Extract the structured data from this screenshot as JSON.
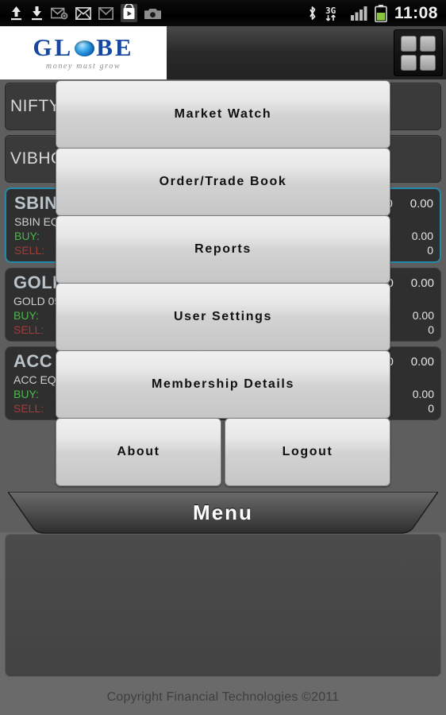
{
  "statusbar": {
    "time": "11:08",
    "left_icons": [
      "upload-icon",
      "download-icon",
      "mail-sync-icon",
      "mail-icon",
      "gmail-icon",
      "play-store-icon",
      "camera-icon"
    ],
    "right_icons": [
      "bluetooth-icon",
      "3g-data-icon",
      "signal-icon",
      "battery-icon"
    ],
    "network_label": "3G"
  },
  "titlebar": {
    "logo_prefix": "GL",
    "logo_suffix": "BE",
    "logo_tagline": "money must grow",
    "grid_icon": "grid-menu-icon"
  },
  "watchlist": {
    "rows": [
      {
        "type": "simple",
        "name": "NIFTY",
        "icon": "chart-icon",
        "values": []
      },
      {
        "type": "simple",
        "name": "VIBHO",
        "icon": "edit-icon",
        "values": []
      },
      {
        "type": "quote",
        "symbol": "SBIN",
        "desc": "SBIN EQ",
        "price": "0",
        "change": "0.00",
        "buy_label": "BUY:",
        "sell_label": "SELL:",
        "buy_value": "0.00",
        "sell_value": "0",
        "selected": true
      },
      {
        "type": "quote",
        "symbol": "GOLD",
        "desc": "GOLD 05",
        "price": "0",
        "change": "0.00",
        "buy_label": "BUY:",
        "sell_label": "SELL:",
        "buy_value": "0.00",
        "sell_value": "0",
        "selected": false
      },
      {
        "type": "quote",
        "symbol": "ACC",
        "desc": "ACC EQ N",
        "price": "0",
        "change": "0.00",
        "buy_label": "BUY:",
        "sell_label": "SELL:",
        "buy_value": "0.00",
        "sell_value": "0",
        "selected": false
      }
    ]
  },
  "menu": {
    "tab_label": "Menu",
    "items": [
      {
        "label": "Market Watch"
      },
      {
        "label": "Order/Trade Book"
      },
      {
        "label": "Reports"
      },
      {
        "label": "User Settings"
      },
      {
        "label": "Membership Details"
      }
    ],
    "bottom_row": [
      {
        "label": "About"
      },
      {
        "label": "Logout"
      }
    ]
  },
  "footer": {
    "copyright": "Copyright Financial Technologies ©2011"
  },
  "colors": {
    "accent_selected": "#2389a8",
    "buy": "#49b849",
    "sell": "#a33b3b",
    "logo_blue": "#17479e",
    "battery_green": "#8cc63f"
  }
}
